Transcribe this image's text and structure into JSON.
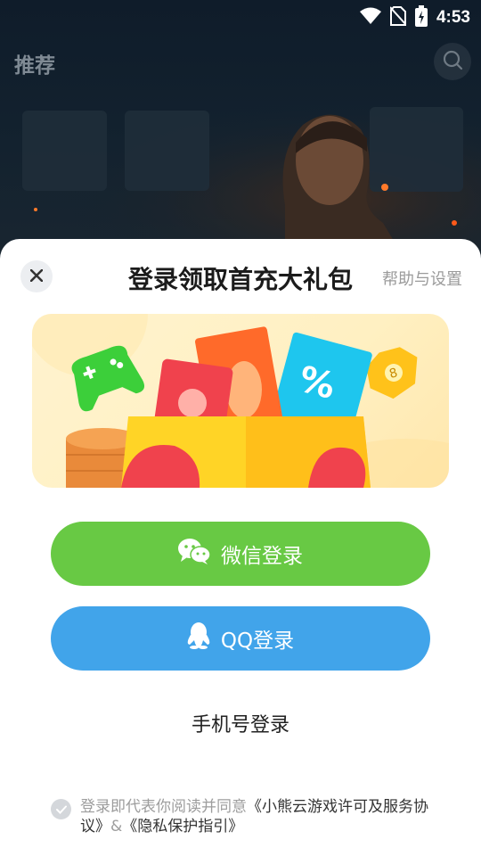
{
  "status_bar": {
    "time": "4:53"
  },
  "top_nav": {
    "title": "推荐"
  },
  "login_sheet": {
    "title": "登录领取首充大礼包",
    "help_link": "帮助与设置",
    "wechat_button": "微信登录",
    "qq_button": "QQ登录",
    "phone_login": "手机号登录",
    "agreement": {
      "prefix": "登录即代表你阅读并同意",
      "license_link": "《小熊云游戏许可及服务协议》",
      "separator": "&",
      "privacy_link": "《隐私保护指引》"
    }
  },
  "colors": {
    "wechat_green": "#68c944",
    "qq_blue": "#41a4ea",
    "banner_bg": "#fff3cf"
  },
  "icons": [
    "wifi-icon",
    "no-sim-icon",
    "battery-charging-icon",
    "search-icon",
    "close-icon",
    "wechat-icon",
    "qq-icon",
    "check-icon"
  ]
}
